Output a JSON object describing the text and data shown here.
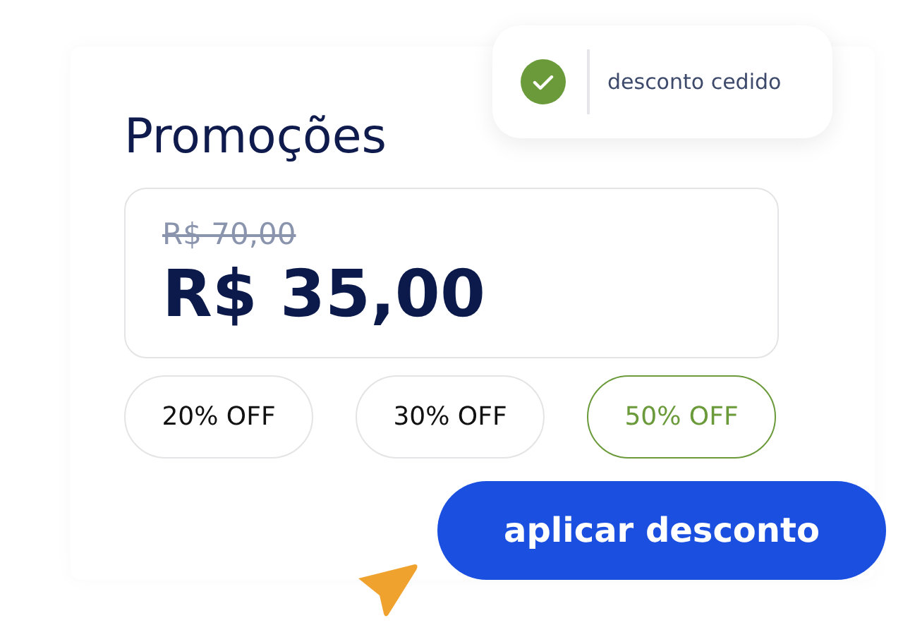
{
  "toast": {
    "text": "desconto cedido"
  },
  "title": "Promoções",
  "price": {
    "original": "R$ 70,00",
    "current": "R$ 35,00"
  },
  "discounts": [
    {
      "label": "20% OFF",
      "selected": false
    },
    {
      "label": "30% OFF",
      "selected": false
    },
    {
      "label": "50% OFF",
      "selected": true
    }
  ],
  "button": {
    "label": "aplicar desconto"
  }
}
